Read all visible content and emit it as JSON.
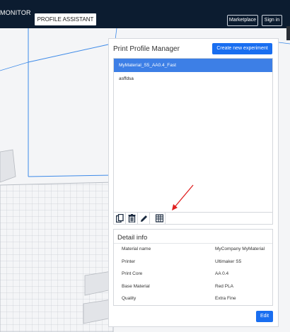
{
  "header": {
    "tabs": [
      {
        "label": "MONITOR"
      },
      {
        "label": "PROFILE ASSISTANT",
        "active": true
      }
    ],
    "marketplace_label": "Marketplace",
    "signin_label": "Sign in",
    "bg_color": "#0c1c30"
  },
  "panel": {
    "title": "Print Profile Manager",
    "create_button_label": "Create new experiment",
    "profiles": [
      {
        "label": "MyMaterial_S5_AA0.4_Fast",
        "selected": true
      },
      {
        "label": "asffdsa",
        "selected": false
      }
    ],
    "toolbar": [
      {
        "icon": "duplicate-icon"
      },
      {
        "icon": "trash-icon"
      },
      {
        "icon": "pencil-icon"
      },
      {
        "icon": "table-icon"
      }
    ],
    "accent_color": "#196ef0",
    "selected_color": "#3d7fe6"
  },
  "detail": {
    "title": "Detail info",
    "rows": [
      {
        "label": "Material name",
        "value": "MyCompany MyMaterial"
      },
      {
        "label": "Printer",
        "value": "Ultimaker S5"
      },
      {
        "label": "Print Core",
        "value": "AA 0.4"
      },
      {
        "label": "Base Material",
        "value": "Red PLA"
      },
      {
        "label": "Quality",
        "value": "Extra Fine"
      }
    ],
    "edit_button_label": "Edit"
  }
}
